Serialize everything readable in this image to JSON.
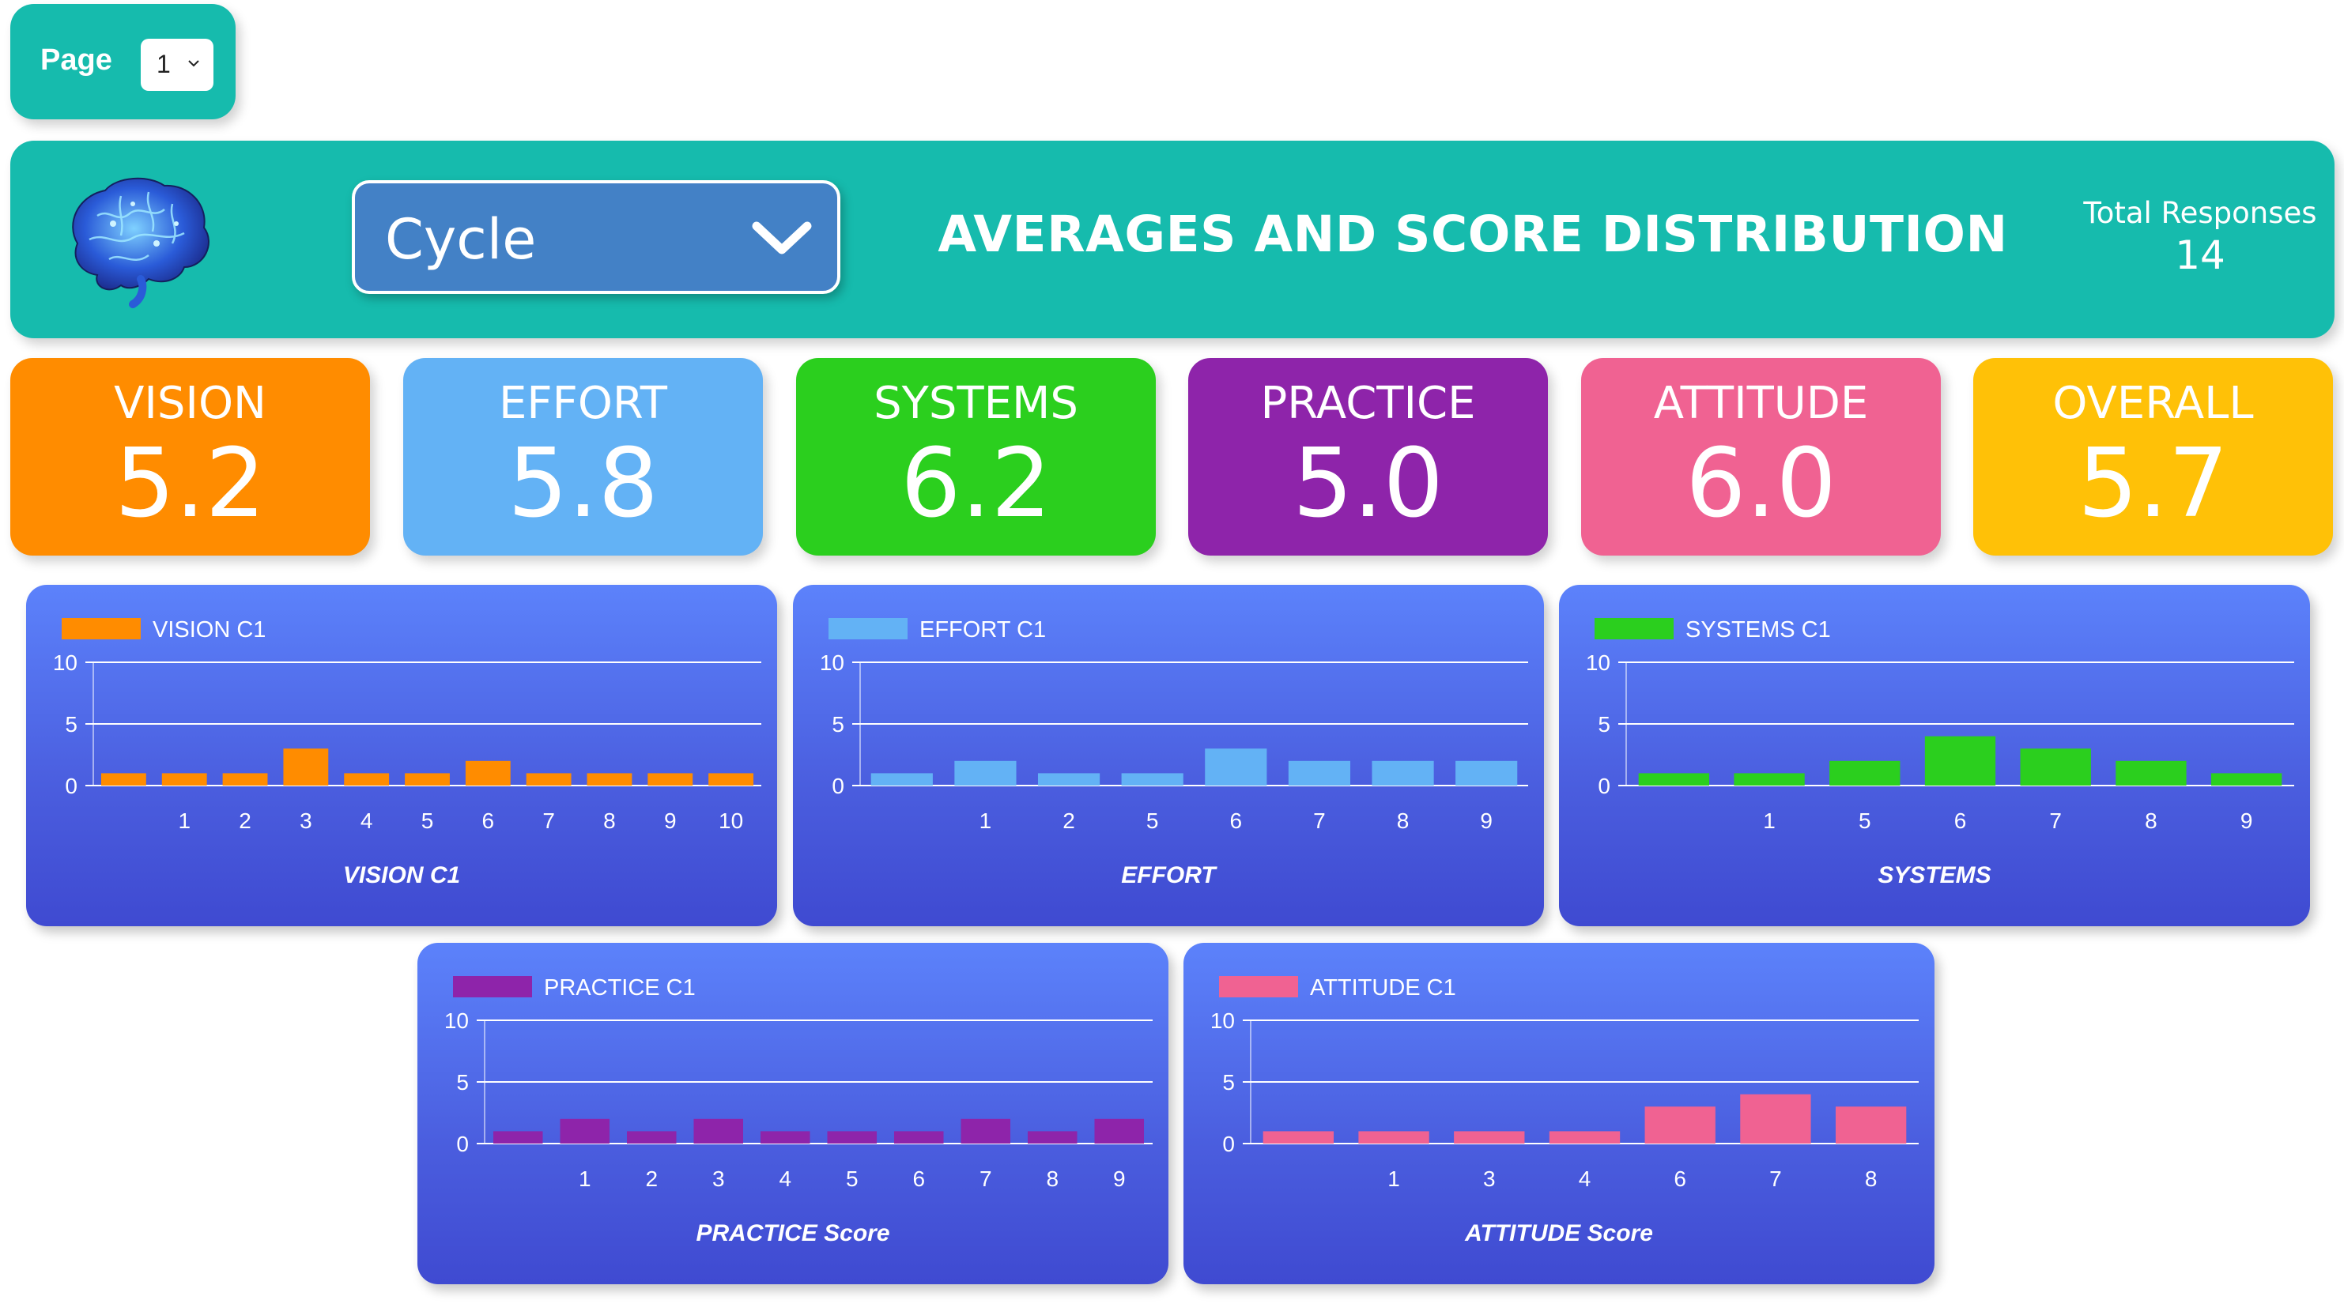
{
  "page_selector": {
    "label": "Page",
    "value": "1"
  },
  "header": {
    "cycle_select": "Cycle",
    "title": "AVERAGES AND SCORE DISTRIBUTION",
    "total_label": "Total Responses",
    "total_value": "14"
  },
  "colors": {
    "teal": "#16BBAD",
    "vision": "#FF8C00",
    "effort": "#63B2F5",
    "systems": "#2BCF1E",
    "practice": "#8E24AA",
    "attitude": "#F06292",
    "overall": "#FFC107",
    "card_top": "#5C82FB",
    "card_bottom": "#3F4AD1"
  },
  "tiles": [
    {
      "label": "VISION",
      "value": "5.2",
      "color": "#FF8C00"
    },
    {
      "label": "EFFORT",
      "value": "5.8",
      "color": "#63B2F5"
    },
    {
      "label": "SYSTEMS",
      "value": "6.2",
      "color": "#2BCF1E"
    },
    {
      "label": "PRACTICE",
      "value": "5.0",
      "color": "#8E24AA"
    },
    {
      "label": "ATTITUDE",
      "value": "6.0",
      "color": "#F06292"
    },
    {
      "label": "OVERALL",
      "value": "5.7",
      "color": "#FFC107"
    }
  ],
  "chart_data": [
    {
      "type": "bar",
      "legend": "VISION C1",
      "color": "#FF8C00",
      "categories": [
        "",
        "1",
        "2",
        "3",
        "4",
        "5",
        "6",
        "7",
        "8",
        "9",
        "10"
      ],
      "values": [
        1,
        1,
        1,
        3,
        1,
        1,
        2,
        1,
        1,
        1,
        1
      ],
      "xlabel": "VISION C1",
      "yticks": [
        "0",
        "5",
        "10"
      ],
      "ylim": [
        0,
        10
      ],
      "grid": true,
      "legend_position": "top-left"
    },
    {
      "type": "bar",
      "legend": "EFFORT C1",
      "color": "#63B2F5",
      "categories": [
        "",
        "1",
        "2",
        "5",
        "6",
        "7",
        "8",
        "9"
      ],
      "values": [
        1,
        2,
        1,
        1,
        3,
        2,
        2,
        2
      ],
      "xlabel": "EFFORT",
      "yticks": [
        "0",
        "5",
        "10"
      ],
      "ylim": [
        0,
        10
      ],
      "grid": true,
      "legend_position": "top-left"
    },
    {
      "type": "bar",
      "legend": "SYSTEMS C1",
      "color": "#2BCF1E",
      "categories": [
        "",
        "1",
        "5",
        "6",
        "7",
        "8",
        "9"
      ],
      "values": [
        1,
        1,
        2,
        4,
        3,
        2,
        1
      ],
      "xlabel": "SYSTEMS",
      "yticks": [
        "0",
        "5",
        "10"
      ],
      "ylim": [
        0,
        10
      ],
      "grid": true,
      "legend_position": "top-left"
    },
    {
      "type": "bar",
      "legend": "PRACTICE C1",
      "color": "#8E24AA",
      "categories": [
        "",
        "1",
        "2",
        "3",
        "4",
        "5",
        "6",
        "7",
        "8",
        "9"
      ],
      "values": [
        1,
        2,
        1,
        2,
        1,
        1,
        1,
        2,
        1,
        2
      ],
      "xlabel": "PRACTICE Score",
      "yticks": [
        "0",
        "5",
        "10"
      ],
      "ylim": [
        0,
        10
      ],
      "grid": true,
      "legend_position": "top-left"
    },
    {
      "type": "bar",
      "legend": "ATTITUDE C1",
      "color": "#F06292",
      "categories": [
        "",
        "1",
        "3",
        "4",
        "6",
        "7",
        "8"
      ],
      "values": [
        1,
        1,
        1,
        1,
        3,
        4,
        3
      ],
      "xlabel": "ATTITUDE Score",
      "yticks": [
        "0",
        "5",
        "10"
      ],
      "ylim": [
        0,
        10
      ],
      "grid": true,
      "legend_position": "top-left"
    }
  ]
}
